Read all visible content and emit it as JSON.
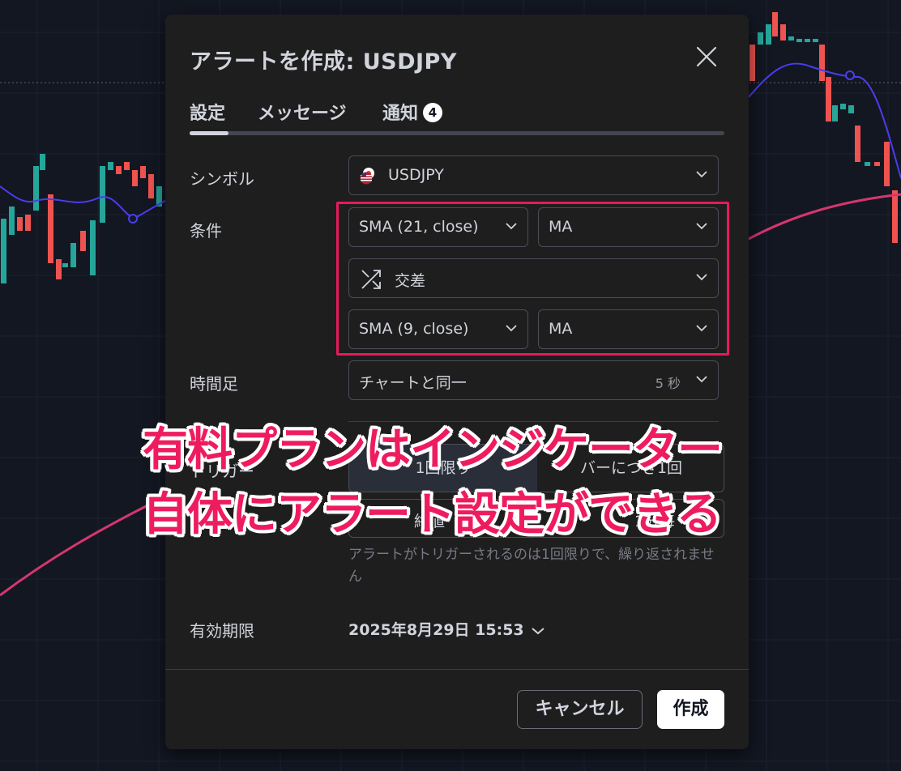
{
  "dialog": {
    "title": "アラートを作成: USDJPY",
    "tabs": [
      {
        "label": "設定"
      },
      {
        "label": "メッセージ"
      },
      {
        "label": "通知",
        "badge": "4"
      }
    ]
  },
  "symbol": {
    "label": "シンボル",
    "value": "USDJPY"
  },
  "condition": {
    "label": "条件",
    "first": {
      "indicator": "SMA (21, close)",
      "plot": "MA"
    },
    "operator": "交差",
    "second": {
      "indicator": "SMA (9, close)",
      "plot": "MA"
    }
  },
  "timeframe": {
    "label": "時間足",
    "value": "チャートと同一",
    "hint": "5 秒"
  },
  "trigger": {
    "label": "トリガー",
    "options": [
      "1回限り",
      "バーにつき1回"
    ],
    "selected": 0,
    "row2": [
      "終値",
      "1分毎"
    ]
  },
  "help_text": "アラートがトリガーされるのは1回限りで、繰り返されません",
  "expiry": {
    "label": "有効期限",
    "value": "2025年8月29日 15:53"
  },
  "buttons": {
    "cancel": "キャンセル",
    "create": "作成"
  },
  "annotation": {
    "line1": "有料プランはインジケーター",
    "line2": "自体にアラート設定ができる"
  },
  "colors": {
    "background": "#131722",
    "dialog": "#1e1e1e",
    "highlight": "#e8195b",
    "annotation": "#ee1c5f",
    "candle_up": "#26a69a",
    "candle_down": "#ef5350",
    "ma_fast": "#3f3fd9",
    "ma_slow": "#d6366e"
  },
  "icons": {
    "close": "close-icon",
    "chevron": "chevron-down-icon",
    "symbol": "us-jp-flag-icon",
    "operator": "cross-arrows-icon"
  }
}
